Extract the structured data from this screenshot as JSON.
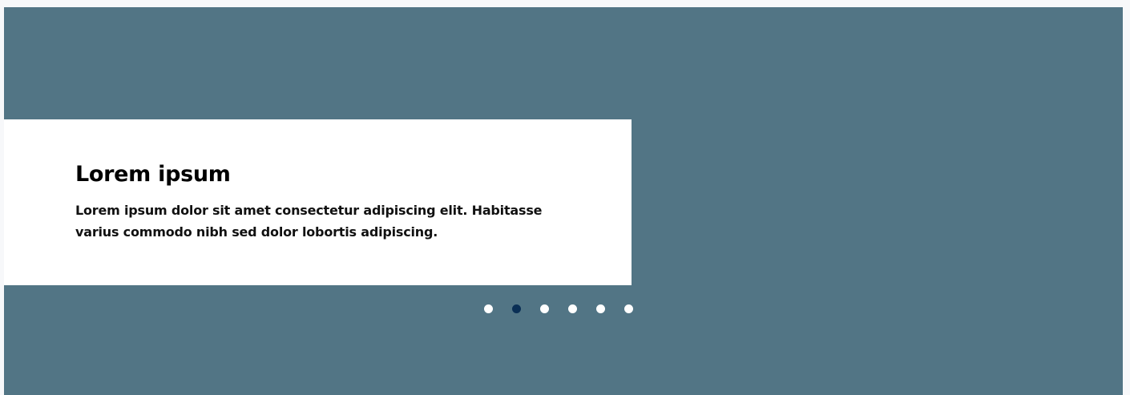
{
  "carousel": {
    "background_color": "#527585",
    "slide": {
      "title": "Lorem ipsum",
      "body": "Lorem ipsum dolor sit amet consectetur adipiscing elit. Habitasse varius commodo nibh sed dolor lobortis adipiscing."
    },
    "pagination": {
      "total": 6,
      "active_index": 1,
      "active_color": "#0a2f55",
      "inactive_color": "#ffffff"
    }
  }
}
